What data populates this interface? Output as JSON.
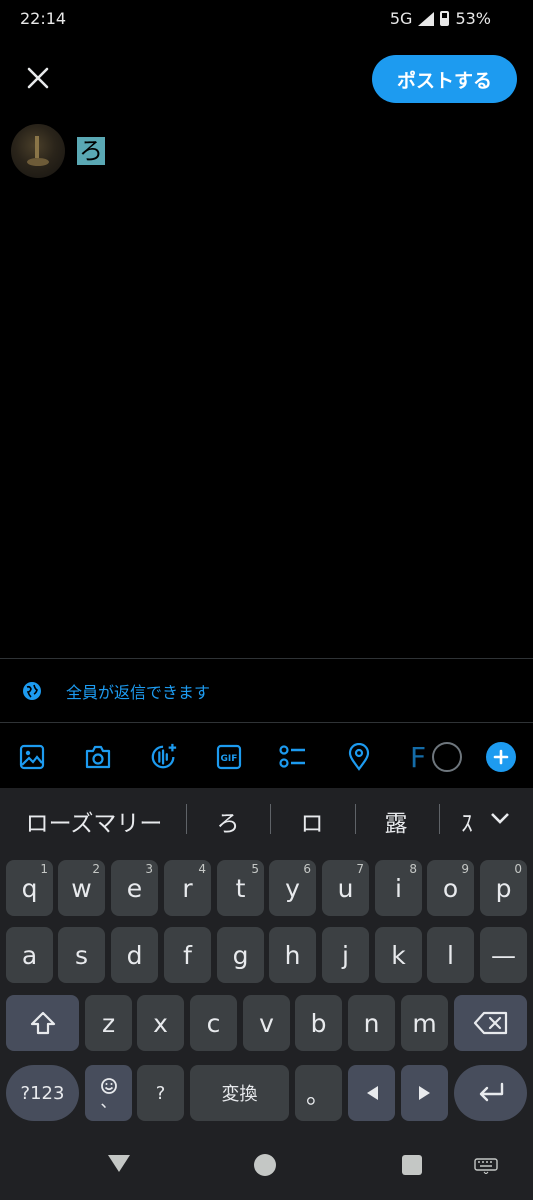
{
  "status_bar": {
    "time": "22:14",
    "network": "5G",
    "battery": "53%"
  },
  "header": {
    "post_label": "ポストする"
  },
  "compose": {
    "text": "ろ"
  },
  "reply_setting": {
    "label": "全員が返信できます"
  },
  "toolbar": {
    "gif_label": "GIF",
    "extra_letter": "F"
  },
  "keyboard": {
    "suggestions": [
      "ローズマリー",
      "ろ",
      "ロ",
      "露",
      "ｽ"
    ],
    "row1": [
      {
        "label": "q",
        "hint": "1"
      },
      {
        "label": "w",
        "hint": "2"
      },
      {
        "label": "e",
        "hint": "3"
      },
      {
        "label": "r",
        "hint": "4"
      },
      {
        "label": "t",
        "hint": "5"
      },
      {
        "label": "y",
        "hint": "6"
      },
      {
        "label": "u",
        "hint": "7"
      },
      {
        "label": "i",
        "hint": "8"
      },
      {
        "label": "o",
        "hint": "9"
      },
      {
        "label": "p",
        "hint": "0"
      }
    ],
    "row2": [
      "a",
      "s",
      "d",
      "f",
      "g",
      "h",
      "j",
      "k",
      "l",
      "—"
    ],
    "row3": [
      "z",
      "x",
      "c",
      "v",
      "b",
      "n",
      "m"
    ],
    "row4": {
      "symbols": "?123",
      "emoji_sub": "、",
      "question": "?",
      "convert": "変換",
      "period": "。"
    }
  },
  "colors": {
    "accent": "#1d9bf0",
    "keyboard_bg": "#202124",
    "key_bg": "#3c4043",
    "special_key_bg": "#474d5c"
  }
}
